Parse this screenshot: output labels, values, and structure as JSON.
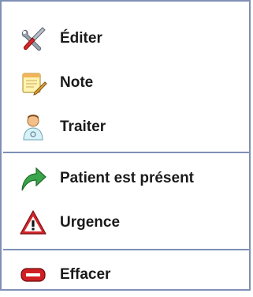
{
  "context_menu": {
    "items": [
      {
        "label": "Éditer",
        "icon": "tools-icon"
      },
      {
        "label": "Note",
        "icon": "note-pencil-icon"
      },
      {
        "label": "Traiter",
        "icon": "doctor-icon"
      },
      {
        "label": "Patient est présent",
        "icon": "green-arrow-icon"
      },
      {
        "label": "Urgence",
        "icon": "warning-icon"
      },
      {
        "label": "Effacer",
        "icon": "delete-icon"
      }
    ]
  },
  "colors": {
    "border": "#7f8fb6",
    "separator": "#7f8fb6",
    "text": "#1a1a1a"
  }
}
